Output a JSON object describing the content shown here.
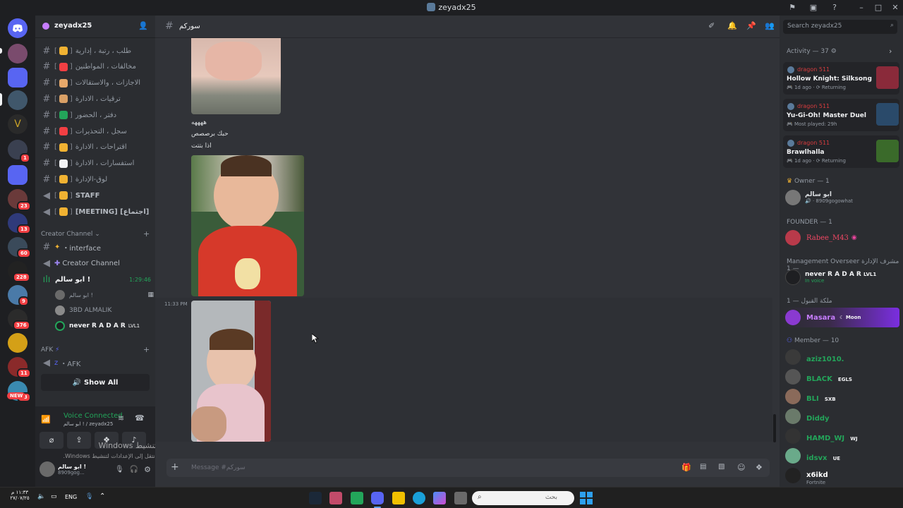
{
  "window": {
    "title": "zeyadx25"
  },
  "server": {
    "name": "zeyadx25"
  },
  "channels": [
    {
      "label": "طلب ، رتبة ، إدارية",
      "emoji_color": "#f0b232"
    },
    {
      "label": "مخالفات ، المواطنين",
      "emoji_color": "#f23f43"
    },
    {
      "label": "الاجازات ، والاستقالات",
      "emoji_color": "#e7a86a"
    },
    {
      "label": "ترقيات ، الادارة",
      "emoji_color": "#d9a066"
    },
    {
      "label": "دفتر ، الحضور",
      "emoji_color": "#23a55a"
    },
    {
      "label": "سجل ، التحذيرات",
      "emoji_color": "#f23f43"
    },
    {
      "label": "اقتراحات ، الادارة",
      "emoji_color": "#f0b232"
    },
    {
      "label": "استفسارات ، الادارة",
      "emoji_color": "#f2f3f5"
    },
    {
      "label": "لوق-الإدارة",
      "emoji_color": "#f0b232"
    },
    {
      "label": "STAFF",
      "emoji_color": "#f0b232"
    },
    {
      "label": "[اجتماع] [MEETING]",
      "emoji_color": "#f0b232"
    }
  ],
  "creator_category": "Creator Channel",
  "creator_channels": [
    {
      "label": "・interface"
    },
    {
      "label": "Creator Channel"
    }
  ],
  "voice_channel": {
    "name": "ابو سالم !",
    "timer": "1:29:46"
  },
  "voice_users": [
    {
      "name": "ابو سالم !"
    },
    {
      "name": "3BD ALMALIK"
    },
    {
      "name": "never R A D A R",
      "badge": "LVL1"
    }
  ],
  "afk_category": "AFK",
  "afk_channel": "・AFK",
  "show_all": "Show All",
  "voice_panel": {
    "status": "Voice Connected",
    "sub": "ابو سالم ! / zeyadx25"
  },
  "user_panel": {
    "name": "ابو سالم !",
    "tag": "8909gog..."
  },
  "windows_watermark": {
    "line1": "تنشيط Windows",
    "line2": "انتقل إلى الإعدادات لتنشيط Windows."
  },
  "chat": {
    "channel": "سوركم",
    "lines": [
      "ههههه",
      "حبك برصصص",
      "اذا بتتت"
    ],
    "timestamp": "11:33 PM",
    "input_placeholder": "Message #سوركم"
  },
  "members": {
    "search_placeholder": "Search zeyadx25",
    "activity_header": "Activity — 37",
    "activities": [
      {
        "user": "dragon 511",
        "game": "Hollow Knight: Silksong",
        "meta": "1d ago",
        "meta2": "Returning"
      },
      {
        "user": "dragon 511",
        "game": "Yu-Gi-Oh! Master Duel",
        "meta": "Most played: 29h",
        "meta2": ""
      },
      {
        "user": "dragon 511",
        "game": "Brawlhalla",
        "meta": "1d ago",
        "meta2": "Returning"
      }
    ],
    "owner_header": "Owner — 1",
    "owner": {
      "name": "ابو سالم",
      "sub": "8909gogowhat"
    },
    "founder_header": "FOUNDER — 1",
    "founder": {
      "name": "Rabee_M43"
    },
    "mgmt_header": "Management Overseer مشرف الإدارة — 1",
    "mgmt": {
      "name": "never R A D A R",
      "badge": "LVL1",
      "sub": "In voice"
    },
    "queen_header": "ملكة القبول — 1",
    "queen": {
      "name": "Masara",
      "badge": "Moon"
    },
    "member_header": "Member — 10",
    "member_list": [
      {
        "name": "aziz1010.",
        "badge": "",
        "color": "#23a55a"
      },
      {
        "name": "BLACK",
        "badge": "EGLS",
        "color": "#23a55a"
      },
      {
        "name": "BLI",
        "badge": "SXB",
        "color": "#23a55a"
      },
      {
        "name": "Diddy",
        "badge": "",
        "color": "#23a55a"
      },
      {
        "name": "HAMD_WJ",
        "badge": "WJ",
        "color": "#23a55a"
      },
      {
        "name": "idsvx",
        "badge": "UE",
        "color": "#23a55a"
      },
      {
        "name": "x6ikd",
        "badge": "",
        "sub": "Fortnite",
        "color": "#ffffff"
      }
    ]
  },
  "taskbar": {
    "time": "١١:٣٣ م",
    "date": "٢٧/٠٧/٢٥",
    "lang": "ENG",
    "search_placeholder": "بحث"
  },
  "servers": [
    {
      "label": "",
      "badge": ""
    },
    {
      "label": "",
      "badge": ""
    },
    {
      "label": "",
      "badge": "1"
    },
    {
      "label": "",
      "badge": "23"
    },
    {
      "label": "",
      "badge": "13"
    },
    {
      "label": "",
      "badge": "60"
    },
    {
      "label": "",
      "badge": "228"
    },
    {
      "label": "",
      "badge": "9"
    },
    {
      "label": "",
      "badge": "376"
    },
    {
      "label": "",
      "badge": "11"
    },
    {
      "label": "",
      "badge": "23"
    }
  ],
  "new_label": "NEW"
}
